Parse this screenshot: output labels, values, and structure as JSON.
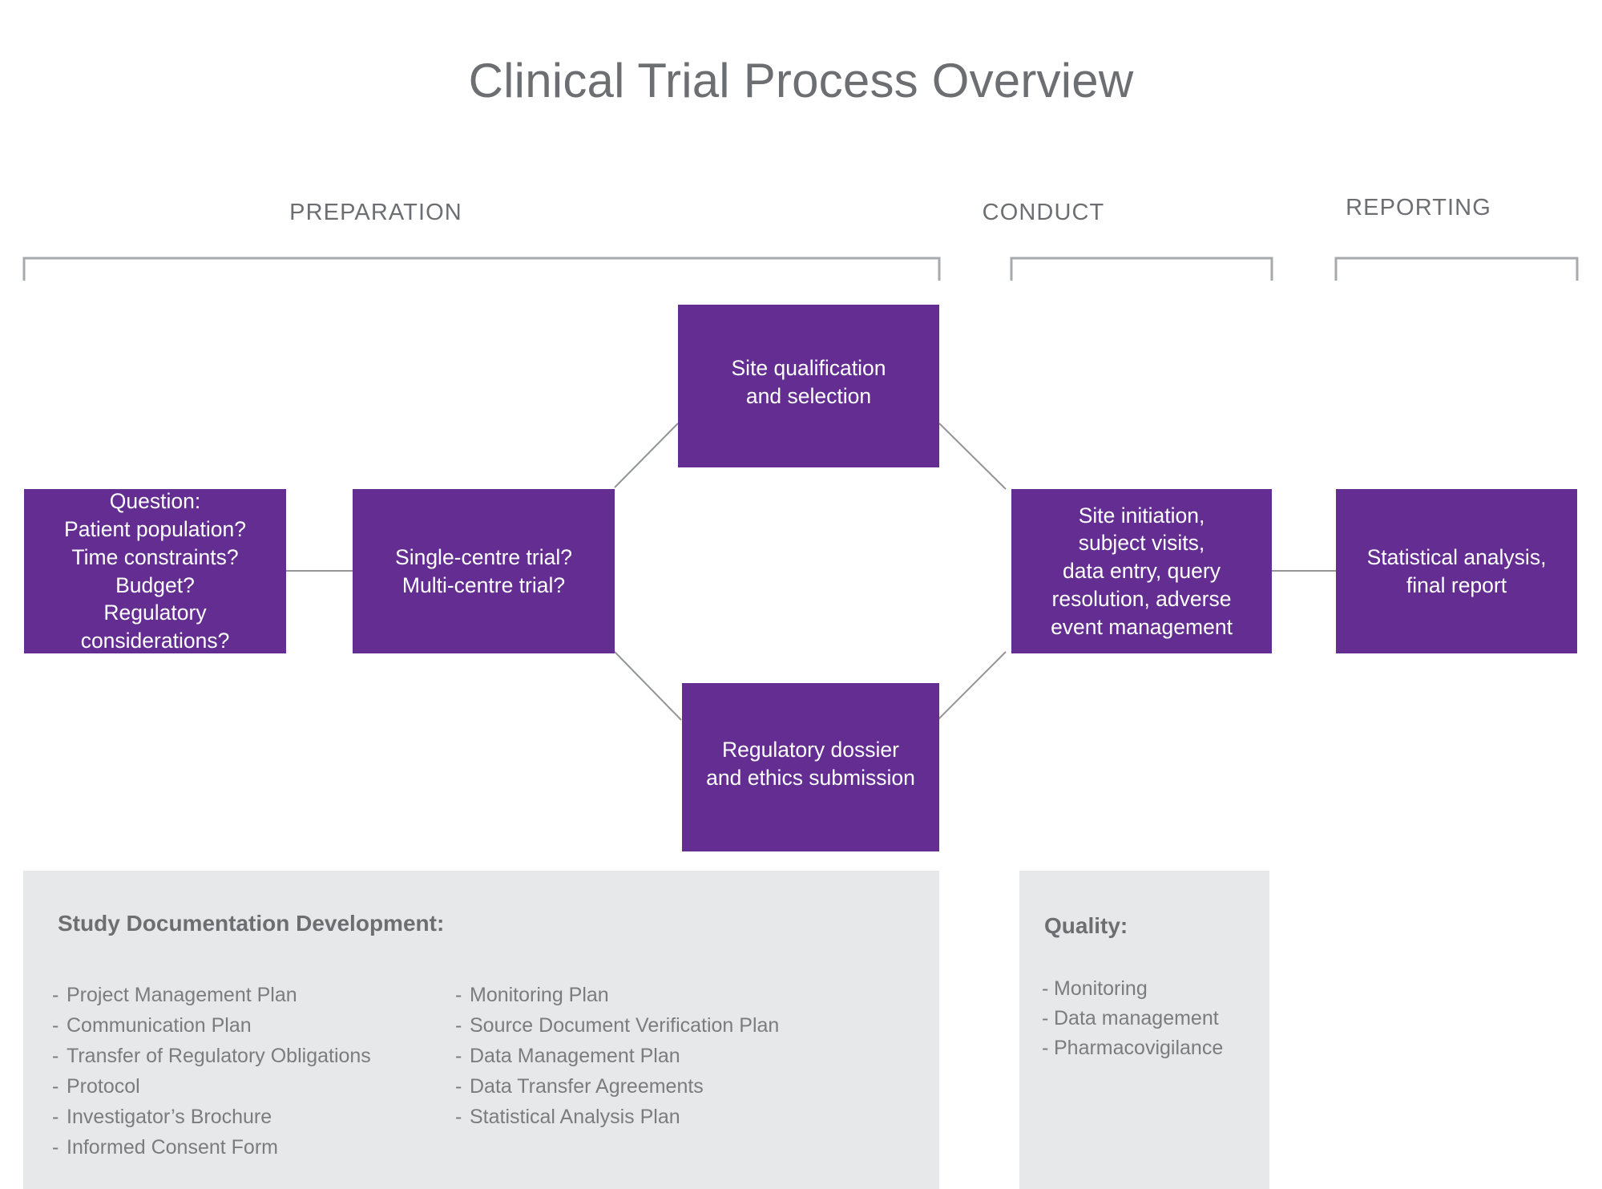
{
  "title": "Clinical Trial Process Overview",
  "phases": [
    {
      "label": "PREPARATION"
    },
    {
      "label": "CONDUCT"
    },
    {
      "label": "REPORTING"
    }
  ],
  "nodes": {
    "question": "Question:\nPatient population?\nTime constraints?\nBudget?\nRegulatory\nconsiderations?",
    "centre": "Single-centre trial?\nMulti-centre trial?",
    "site_qualification": "Site qualification\nand selection",
    "regulatory_dossier": "Regulatory dossier\nand ethics submission",
    "site_initiation": "Site initiation,\nsubject visits,\ndata entry, query\nresolution, adverse\nevent management",
    "statistical_analysis": "Statistical analysis,\nfinal report"
  },
  "panels": {
    "documentation": {
      "title": "Study Documentation Development:",
      "column_left": [
        "Project Management Plan",
        "Communication Plan",
        "Transfer of Regulatory Obligations",
        "Protocol",
        "Investigator’s Brochure",
        "Informed Consent Form"
      ],
      "column_right": [
        "Monitoring Plan",
        "Source Document Verification Plan",
        "Data Management Plan",
        "Data Transfer Agreements",
        "Statistical Analysis Plan"
      ],
      "bullet": "-"
    },
    "quality": {
      "title": "Quality:",
      "items": [
        "Monitoring",
        "Data management",
        "Pharmacovigilance"
      ],
      "bullet": "-"
    }
  },
  "colors": {
    "node_fill": "#632d91",
    "node_text": "#ffffff",
    "panel_fill": "#e7e8e9",
    "text_gray": "#6d6e71",
    "list_gray": "#7b7c7f",
    "line_gray": "#a7a9ac",
    "background": "#ffffff"
  }
}
